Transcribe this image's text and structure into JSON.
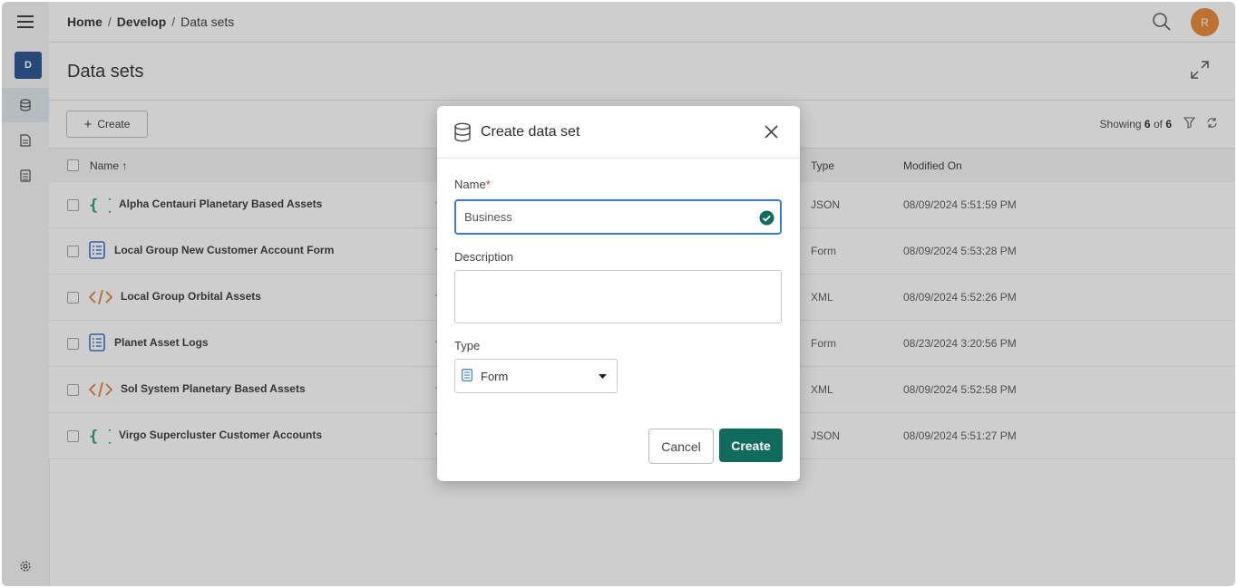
{
  "breadcrumb": [
    "Home",
    "Develop",
    "Data sets"
  ],
  "user_initial": "R",
  "workspace_badge": "D",
  "page_title": "Data sets",
  "toolbar": {
    "create_label": "Create",
    "showing_prefix": "Showing",
    "showing_count": "6",
    "showing_of": "of",
    "showing_total": "6"
  },
  "table": {
    "col_name": "Name",
    "col_type": "Type",
    "col_modified": "Modified On",
    "rows": [
      {
        "icon": "json-braces-icon",
        "name": "Alpha Centauri Planetary Based Assets",
        "type": "JSON",
        "modified": "08/09/2024 5:51:59 PM"
      },
      {
        "icon": "form-icon",
        "name": "Local Group New Customer Account Form",
        "type": "Form",
        "modified": "08/09/2024 5:53:28 PM"
      },
      {
        "icon": "xml-code-icon",
        "name": "Local Group Orbital Assets",
        "type": "XML",
        "modified": "08/09/2024 5:52:26 PM"
      },
      {
        "icon": "form-icon",
        "name": "Planet Asset Logs",
        "type": "Form",
        "modified": "08/23/2024 3:20:56 PM"
      },
      {
        "icon": "xml-code-icon",
        "name": "Sol System Planetary Based Assets",
        "type": "XML",
        "modified": "08/09/2024 5:52:58 PM"
      },
      {
        "icon": "json-braces-icon",
        "name": "Virgo Supercluster Customer Accounts",
        "type": "JSON",
        "modified": "08/09/2024 5:51:27 PM"
      }
    ]
  },
  "modal": {
    "title": "Create data set",
    "name_label": "Name",
    "name_required_mark": "*",
    "name_value": "Business",
    "description_label": "Description",
    "description_value": "",
    "type_label": "Type",
    "type_value": "Form",
    "cancel_label": "Cancel",
    "create_label": "Create"
  },
  "colors": {
    "accent": "#0f6b5c",
    "focus": "#3b7bd8",
    "json": "#1f9d6a",
    "form": "#2f6dc2",
    "xml": "#e07a20",
    "avatar": "#e8852c",
    "badge": "#1f4e8c"
  }
}
